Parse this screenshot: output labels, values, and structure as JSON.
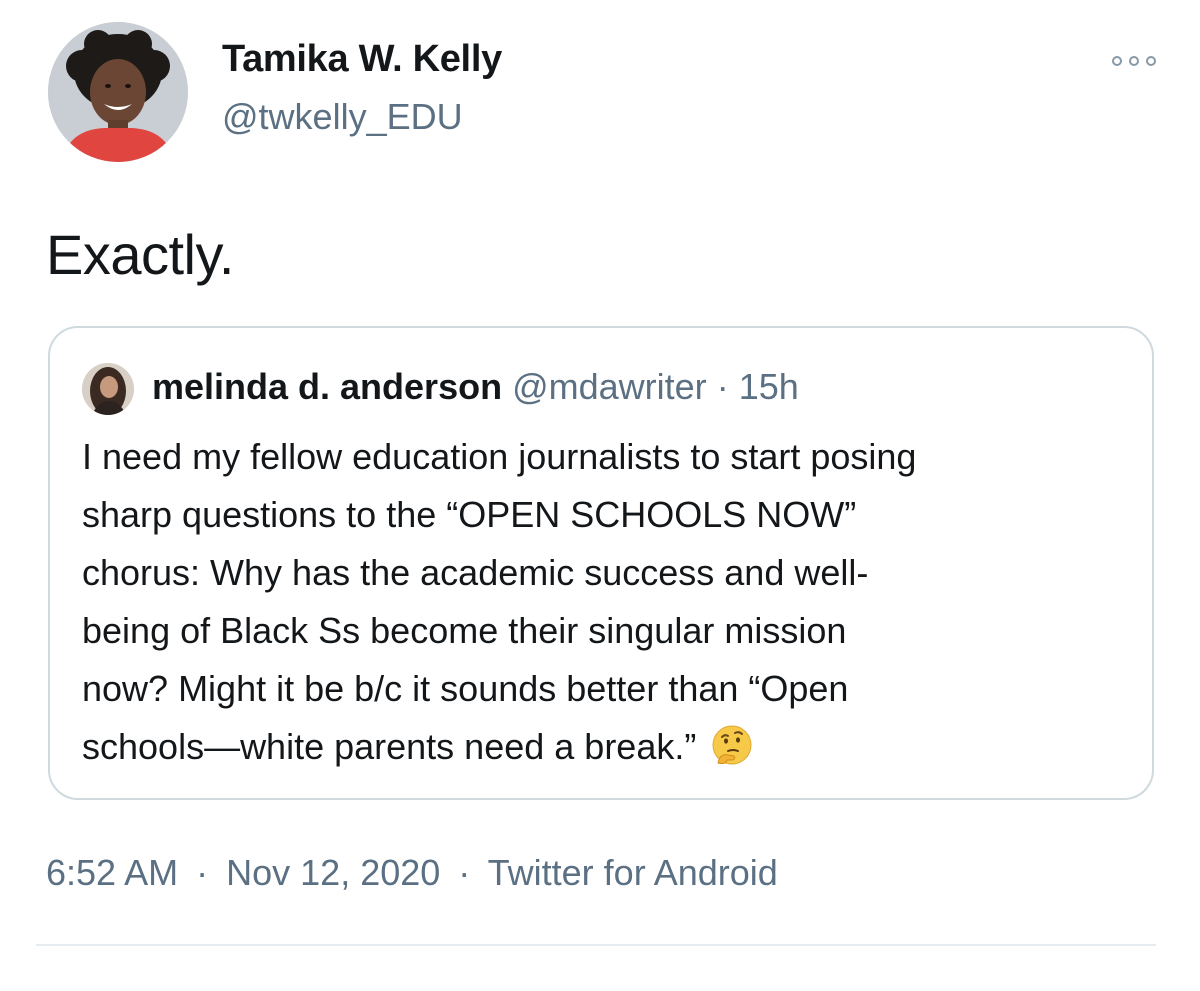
{
  "author": {
    "name": "Tamika W. Kelly",
    "handle": "@twkelly_EDU"
  },
  "tweet": {
    "text": "Exactly."
  },
  "quoted_tweet": {
    "author_name": "melinda d. anderson",
    "author_handle": "@mdawriter",
    "separator": "·",
    "time": "15h",
    "lines": [
      "I need my fellow education journalists to start posing",
      "sharp questions to the “OPEN SCHOOLS NOW”",
      "chorus: Why has the academic success and well-",
      "being of Black Ss become their singular mission",
      "now? Might it be b/c it sounds better than “Open",
      "schools—white parents need a break.”"
    ],
    "emoji": "thinking-face-emoji"
  },
  "footer": {
    "time": "6:52 AM",
    "separator": "·",
    "date": "Nov 12, 2020",
    "source": "Twitter for Android"
  },
  "icons": {
    "more": "more-options-icon"
  },
  "colors": {
    "text_primary": "#14171a",
    "text_secondary": "#5b7083",
    "border": "#cfd9de"
  }
}
